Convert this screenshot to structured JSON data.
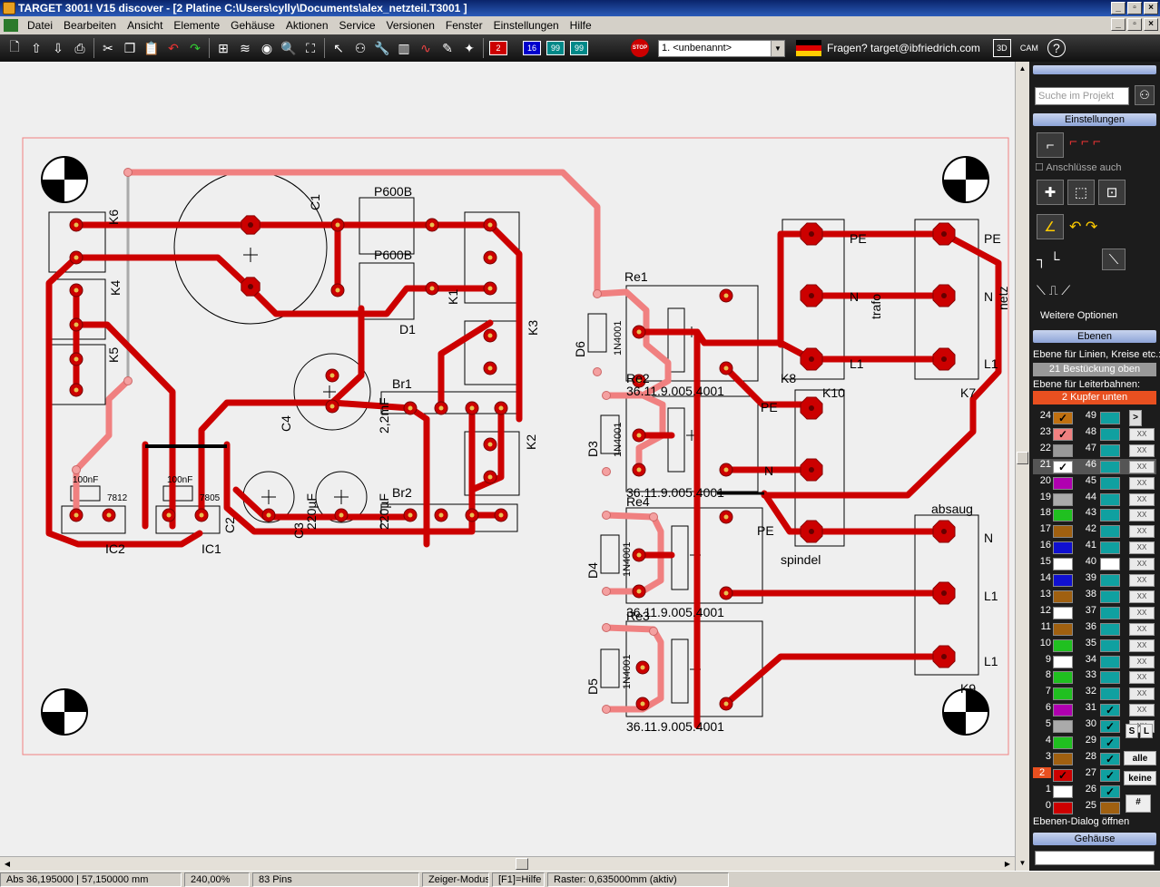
{
  "window": {
    "title": "TARGET 3001! V15 discover - [2 Platine C:\\Users\\cylly\\Documents\\alex_netzteil.T3001 ]"
  },
  "menu": [
    "Datei",
    "Bearbeiten",
    "Ansicht",
    "Elemente",
    "Gehäuse",
    "Aktionen",
    "Service",
    "Versionen",
    "Fenster",
    "Einstellungen",
    "Hilfe"
  ],
  "toolbar": {
    "layer_buttons": [
      "2",
      "16",
      "99",
      "99"
    ],
    "stop": "STOP",
    "combo": "1. <unbenannt>",
    "help": "Fragen? target@ibfriedrich.com",
    "view3d": "3D",
    "cam": "CAM",
    "help_icon": "?"
  },
  "panel": {
    "search_placeholder": "Suche im Projekt",
    "settings": "Einstellungen",
    "pins_also": "Anschlüsse auch",
    "more_options": "Weitere Optionen",
    "layers": "Ebenen",
    "layer_lines_label": "Ebene für Linien, Kreise etc.:",
    "layer_lines_value": "21 Bestückung oben",
    "layer_tracks_label": "Ebene für Leiterbahnen:",
    "layer_tracks_value": "2 Kupfer unten",
    "layer_rows": [
      {
        "a": "24",
        "b": "49"
      },
      {
        "a": "23",
        "b": "48"
      },
      {
        "a": "22",
        "b": "47"
      },
      {
        "a": "21",
        "b": "46"
      },
      {
        "a": "20",
        "b": "45"
      },
      {
        "a": "19",
        "b": "44"
      },
      {
        "a": "18",
        "b": "43"
      },
      {
        "a": "17",
        "b": "42"
      },
      {
        "a": "16",
        "b": "41"
      },
      {
        "a": "15",
        "b": "40"
      },
      {
        "a": "14",
        "b": "39"
      },
      {
        "a": "13",
        "b": "38"
      },
      {
        "a": "12",
        "b": "37"
      },
      {
        "a": "11",
        "b": "36"
      },
      {
        "a": "10",
        "b": "35"
      },
      {
        "a": "9",
        "b": "34"
      },
      {
        "a": "8",
        "b": "33"
      },
      {
        "a": "7",
        "b": "32"
      },
      {
        "a": "6",
        "b": "31"
      },
      {
        "a": "5",
        "b": "30"
      },
      {
        "a": "4",
        "b": "29"
      },
      {
        "a": "3",
        "b": "28"
      },
      {
        "a": "2",
        "b": "27"
      },
      {
        "a": "1",
        "b": "26"
      },
      {
        "a": "0",
        "b": "25"
      }
    ],
    "btn_s": "S",
    "btn_l": "L",
    "btn_all": "alle",
    "btn_none": "keine",
    "btn_hash": "#",
    "expand": ">",
    "layer_dialog": "Ebenen-Dialog öffnen",
    "housing": "Gehäuse"
  },
  "status": {
    "coords": "Abs 36,195000 | 57,150000 mm",
    "zoom": "240,00%",
    "pins": "83 Pins",
    "mode": "Zeiger-Modus",
    "help": "[F1]=Hilfe",
    "grid": "Raster: 0,635000mm (aktiv)"
  },
  "pcb": {
    "labels": [
      "C1",
      "P600B",
      "P600B",
      "D1",
      "K6",
      "K4",
      "K5",
      "K1",
      "K3",
      "Br1",
      "C4",
      "2,2mF",
      "K2",
      "Br2",
      "C2",
      "C3",
      "220µF",
      "220µF",
      "100nF",
      "100nF",
      "IC2",
      "IC1",
      "7812",
      "7805",
      "Re1",
      "Re2",
      "Re3",
      "Re4",
      "D6",
      "D3",
      "D4",
      "D5",
      "1N4001",
      "1N4001",
      "1N4001",
      "1N4001",
      "36.11.9.005.4001",
      "36.11.9.005.4001",
      "36.11.9.005.4001",
      "36.11.9.005.4001",
      "K8",
      "K10",
      "K7",
      "K9",
      "spindel",
      "trafo",
      "netz",
      "absaug",
      "PE",
      "N",
      "L1",
      "PE",
      "N",
      "L1",
      "L1",
      "N",
      "PE",
      "N",
      "L1",
      "PE"
    ]
  }
}
